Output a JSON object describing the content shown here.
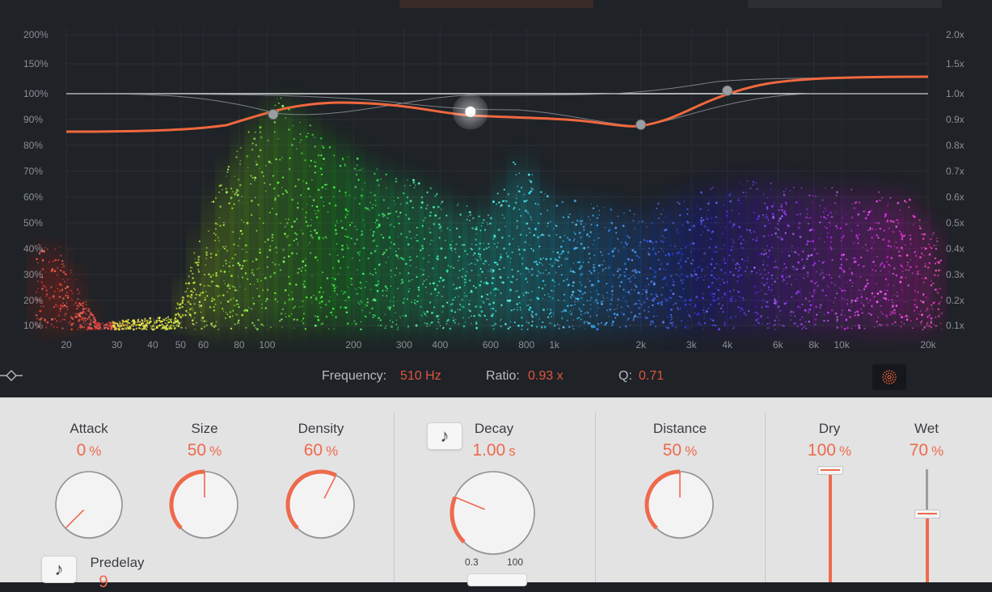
{
  "display": {
    "y_left_ticks": [
      "200%",
      "150%",
      "100%",
      "90%",
      "80%",
      "70%",
      "60%",
      "50%",
      "40%",
      "30%",
      "20%",
      "10%"
    ],
    "y_right_ticks": [
      "2.0x",
      "1.5x",
      "1.0x",
      "0.9x",
      "0.8x",
      "0.7x",
      "0.6x",
      "0.5x",
      "0.4x",
      "0.3x",
      "0.2x",
      "0.1x"
    ],
    "x_ticks": [
      "20",
      "30",
      "40",
      "50",
      "60",
      "80",
      "100",
      "200",
      "300",
      "400",
      "600",
      "800",
      "1k",
      "2k",
      "3k",
      "4k",
      "6k",
      "8k",
      "10k",
      "20k"
    ],
    "x_tick_hz": [
      20,
      30,
      40,
      50,
      60,
      80,
      100,
      200,
      300,
      400,
      600,
      800,
      1000,
      2000,
      3000,
      4000,
      6000,
      8000,
      10000,
      20000
    ],
    "curve_color": "#f0683e",
    "band_nodes": [
      {
        "freq_hz": 105,
        "ratio": 0.92,
        "selected": false
      },
      {
        "freq_hz": 510,
        "ratio": 0.93,
        "selected": true
      },
      {
        "freq_hz": 2000,
        "ratio": 0.88,
        "selected": false
      },
      {
        "freq_hz": 4000,
        "ratio": 1.05,
        "selected": false
      }
    ]
  },
  "params": {
    "frequency_label": "Frequency:",
    "frequency_value": "510 Hz",
    "ratio_label": "Ratio:",
    "ratio_value": "0.93 x",
    "q_label": "Q:",
    "q_value": "0.71"
  },
  "controls": {
    "attack": {
      "label": "Attack",
      "value": "0",
      "unit": "%",
      "level": 0
    },
    "size": {
      "label": "Size",
      "value": "50",
      "unit": "%",
      "level": 0.5
    },
    "density": {
      "label": "Density",
      "value": "60",
      "unit": "%",
      "level": 0.6
    },
    "decay": {
      "label": "Decay",
      "value": "1.00",
      "unit": "s",
      "level": 0.25,
      "range_min": "0.3",
      "range_max": "100"
    },
    "distance": {
      "label": "Distance",
      "value": "50",
      "unit": "%",
      "level": 0.5
    },
    "dry": {
      "label": "Dry",
      "value": "100",
      "unit": "%",
      "level": 1.0
    },
    "wet": {
      "label": "Wet",
      "value": "70",
      "unit": "%",
      "level": 0.7
    },
    "predelay": {
      "label": "Predelay",
      "value": "9"
    }
  },
  "icons": {
    "note": "♪",
    "band_shape": "band-shape-icon",
    "particle": "particle-view-icon"
  },
  "colors": {
    "accent": "#ee6a4c",
    "panel_bg": "#e3e3e4",
    "display_bg": "#1f2227"
  }
}
